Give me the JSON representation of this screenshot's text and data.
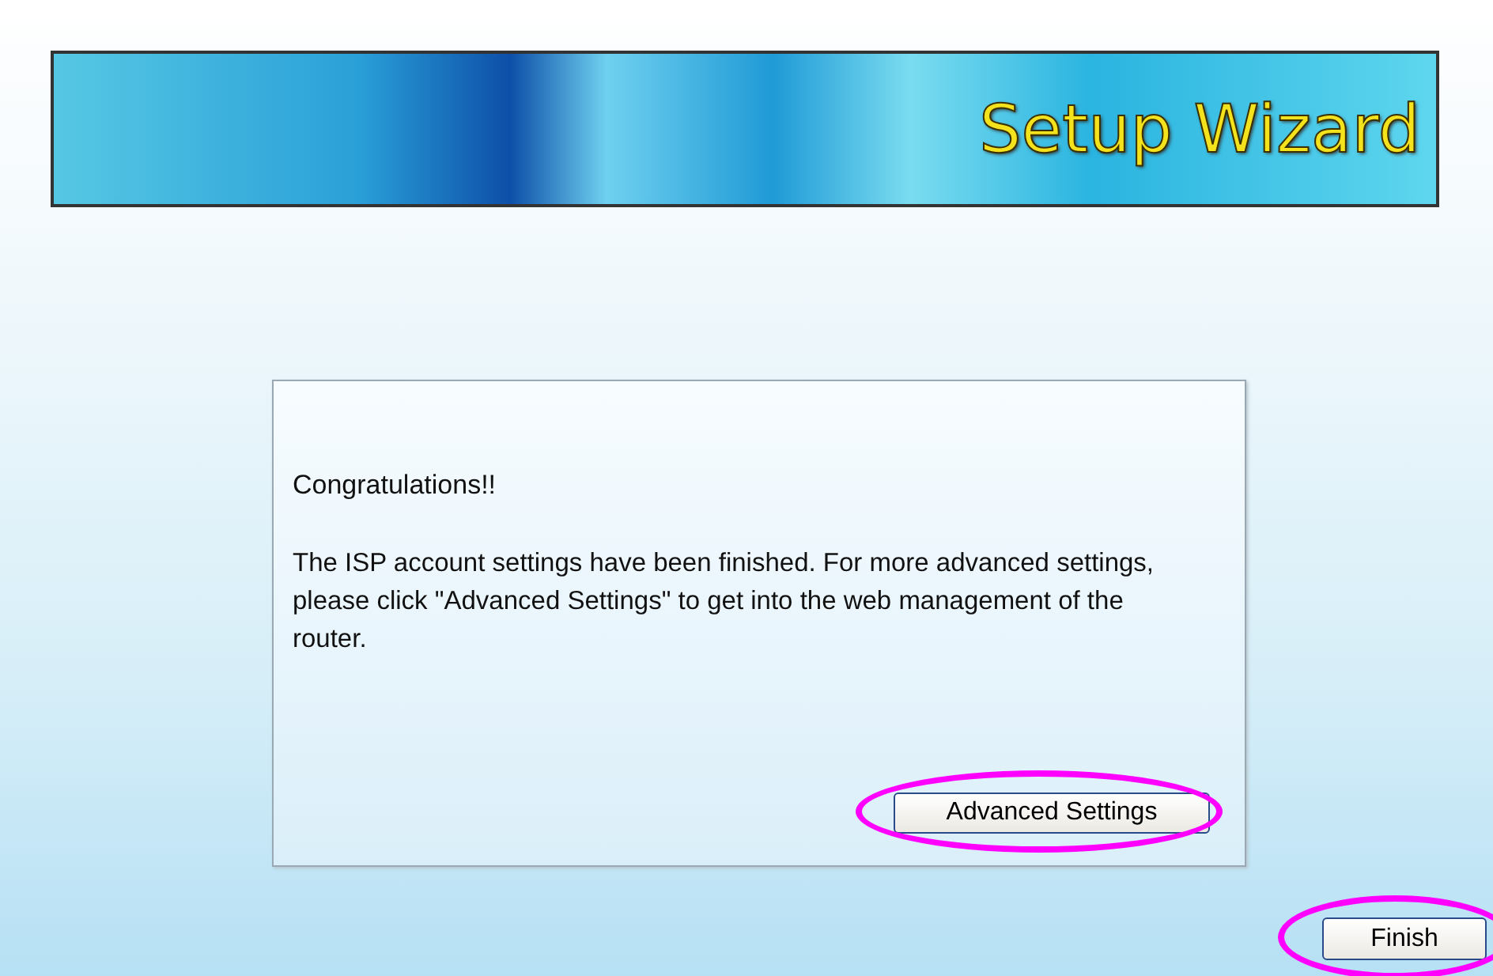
{
  "banner": {
    "title": "Setup Wizard"
  },
  "panel": {
    "heading": "Congratulations!!",
    "message": "The ISP account settings have been finished. For more advanced settings, please click \"Advanced Settings\" to get into the web management of the router.",
    "button": {
      "label": "Advanced Settings",
      "highlighted": true
    }
  },
  "footer_button": {
    "label": "Finish",
    "highlighted": true
  }
}
